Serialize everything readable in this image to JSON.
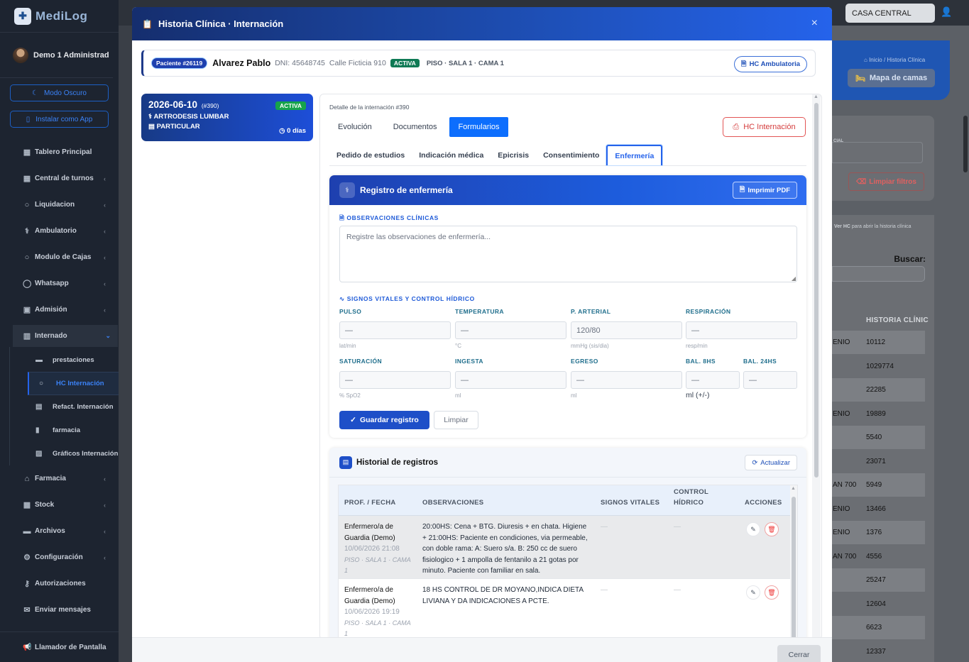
{
  "brand": {
    "name": "MediLog"
  },
  "user": {
    "name": "Demo 1 Administrad"
  },
  "sidebar_buttons": {
    "dark_mode": "Modo Oscuro",
    "install": "Instalar como App"
  },
  "menu": [
    {
      "label": "Tablero Principal",
      "icon": "dashboard-icon",
      "chev": ""
    },
    {
      "label": "Central de turnos",
      "icon": "calendar-icon",
      "chev": "‹"
    },
    {
      "label": "Liquidacion",
      "icon": "circle-icon",
      "chev": "‹"
    },
    {
      "label": "Ambulatorio",
      "icon": "stethoscope-icon",
      "chev": "‹"
    },
    {
      "label": "Modulo de Cajas",
      "icon": "circle-icon",
      "chev": "‹"
    },
    {
      "label": "Whatsapp",
      "icon": "whatsapp-icon",
      "chev": "‹"
    },
    {
      "label": "Admisión",
      "icon": "admission-icon",
      "chev": "‹"
    }
  ],
  "internado": {
    "label": "Internado",
    "chev": "⌄",
    "sub": [
      {
        "label": "prestaciones",
        "icon": "bed-icon"
      },
      {
        "label": "HC Internación",
        "icon": "circle-icon"
      },
      {
        "label": "Refact. Internación",
        "icon": "document-icon"
      },
      {
        "label": "farmacia",
        "icon": "pill-icon"
      },
      {
        "label": "Gráficos Internación",
        "icon": "chart-icon"
      }
    ]
  },
  "menu2": [
    {
      "label": "Farmacia",
      "icon": "home-icon",
      "chev": "‹"
    },
    {
      "label": "Stock",
      "icon": "boxes-icon",
      "chev": "‹"
    },
    {
      "label": "Archivos",
      "icon": "archive-icon",
      "chev": "‹"
    },
    {
      "label": "Configuración",
      "icon": "gear-icon",
      "chev": "‹"
    },
    {
      "label": "Autorizaciones",
      "icon": "key-icon",
      "chev": ""
    },
    {
      "label": "Enviar mensajes",
      "icon": "mail-icon",
      "chev": ""
    }
  ],
  "llamador": "Llamador de Pantalla",
  "topbar": {
    "casa": "CASA CENTRAL"
  },
  "bg": {
    "crumb": "Inicio / Historia Clínica",
    "mapa": "Mapa de camas",
    "cial": "CIAL",
    "limpiar": "Limpiar filtros",
    "verhc_b": "Ver HC",
    "verhc_rest": " para abrir la historia clínica",
    "buscar": "Buscar:",
    "th": "HISTORIA CLÍNIC",
    "rows": [
      {
        "a": "ENIO",
        "b": "10112"
      },
      {
        "a": "",
        "b": "1029774"
      },
      {
        "a": "",
        "b": "22285"
      },
      {
        "a": "ENIO",
        "b": "19889"
      },
      {
        "a": "",
        "b": "5540"
      },
      {
        "a": "",
        "b": "23071"
      },
      {
        "a": "AN 700",
        "b": "5949"
      },
      {
        "a": "ENIO",
        "b": "13466"
      },
      {
        "a": "ENIO",
        "b": "1376"
      },
      {
        "a": "AN 700",
        "b": "4556"
      },
      {
        "a": "",
        "b": "25247"
      },
      {
        "a": "",
        "b": "12604"
      },
      {
        "a": "",
        "b": "6623"
      },
      {
        "a": "",
        "b": "12337"
      }
    ]
  },
  "modal": {
    "title": "Historia Clínica · Internación",
    "close": "×",
    "patient": {
      "id": "Paciente #26119",
      "name": "Alvarez Pablo",
      "dni": "DNI: 45648745",
      "address": "Calle Ficticia 910",
      "status": "ACTIVA",
      "location": "PISO · SALA 1 · CAMA 1",
      "hc_amb": "HC Ambulatoria"
    },
    "intern_card": {
      "date": "2026-06-10",
      "num": "(#390)",
      "status": "ACTIVA",
      "diag": "ARTRODESIS LUMBAR",
      "coverage": "PARTICULAR",
      "days": "0 días"
    },
    "detail_title": "Detalle de la internación #390",
    "tabs": [
      "Evolución",
      "Documentos",
      "Formularios"
    ],
    "hc_int_btn": "HC Internación",
    "subtabs": [
      "Pedido de estudios",
      "Indicación médica",
      "Epicrisis",
      "Consentimiento",
      "Enfermería"
    ],
    "registro": {
      "title": "Registro de enfermería",
      "print": "Imprimir PDF",
      "obs_label": "OBSERVACIONES CLÍNICAS",
      "obs_placeholder": "Registre las observaciones de enfermería...",
      "vitals_label": "SIGNOS VITALES Y CONTROL HÍDRICO",
      "vitals": [
        {
          "label": "PULSO",
          "value": "—",
          "unit": "lat/min"
        },
        {
          "label": "TEMPERATURA",
          "value": "—",
          "unit": "°C"
        },
        {
          "label": "P. ARTERIAL",
          "value": "120/80",
          "unit": "mmHg (sis/dia)"
        },
        {
          "label": "RESPIRACIÓN",
          "value": "—",
          "unit": "resp/min"
        },
        {
          "label": "SATURACIÓN",
          "value": "—",
          "unit": "% SpO2"
        },
        {
          "label": "INGESTA",
          "value": "—",
          "unit": "ml"
        },
        {
          "label": "EGRESO",
          "value": "—",
          "unit": "ml"
        }
      ],
      "bal8_label": "BAL. 8HS",
      "bal24_label": "BAL. 24HS",
      "bal_value": "—",
      "bal_unit": "ml (+/-)",
      "save": "Guardar registro",
      "clear": "Limpiar"
    },
    "historial": {
      "title": "Historial de registros",
      "refresh": "Actualizar",
      "headers": [
        "PROF. / FECHA",
        "OBSERVACIONES",
        "SIGNOS VITALES",
        "CONTROL HÍDRICO",
        "ACCIONES"
      ],
      "rows": [
        {
          "prof": "Enfermero/a de Guardia (Demo)",
          "date": "10/06/2026 21:08",
          "loc": "PISO · SALA 1 · CAMA 1",
          "obs": "20:00HS: Cena + BTG. Diuresis + en chata. Higiene + 21:00HS: Paciente en condiciones, via permeable, con doble rama: A: Suero s/a. B: 250 cc de suero fisiologico + 1 ampolla de fentanilo a 21 gotas por minuto. Paciente con familiar en sala.",
          "vitals": "—",
          "hydric": "—"
        },
        {
          "prof": "Enfermero/a de Guardia (Demo)",
          "date": "10/06/2026 19:19",
          "loc": "PISO · SALA 1 · CAMA 1",
          "obs": "18 HS CONTROL DE DR MOYANO,INDICA DIETA LIVIANA Y DA INDICACIONES A PCTE.",
          "vitals": "—",
          "hydric": "—"
        }
      ]
    },
    "footer_close": "Cerrar"
  }
}
